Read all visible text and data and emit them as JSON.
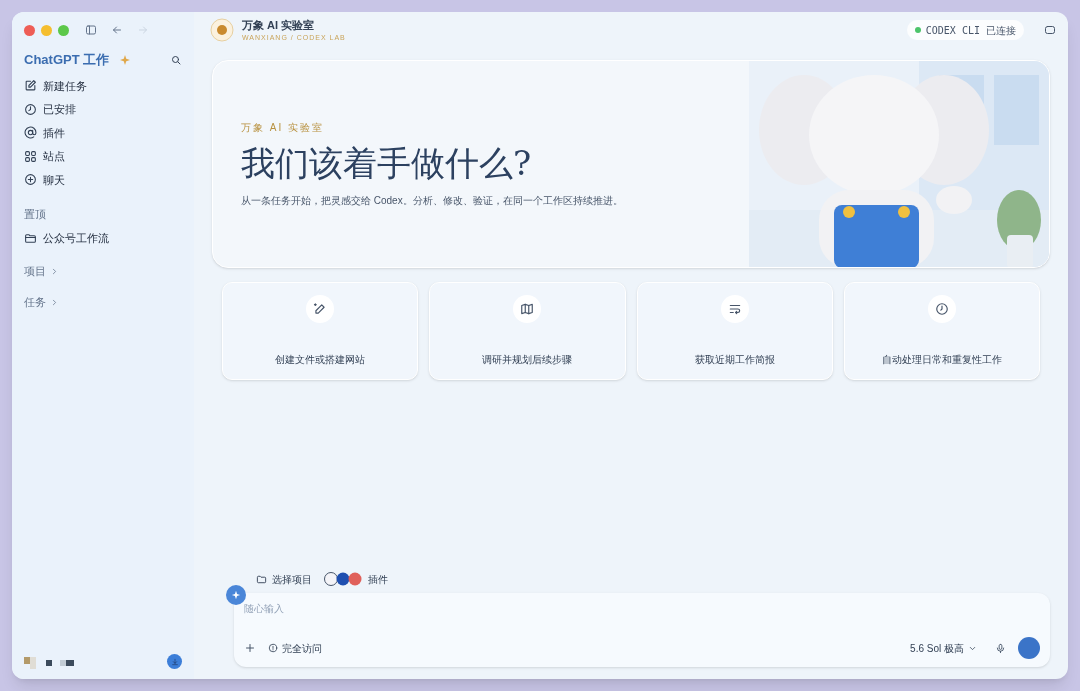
{
  "header": {
    "brand_title": "万象 AI 实验室",
    "brand_subtitle": "WANXIANG / CODEX LAB",
    "status": {
      "text": "CODEX CLI 已连接",
      "connected": true
    }
  },
  "sidebar": {
    "title": "ChatGPT 工作",
    "items": [
      {
        "kind": "edit",
        "label": "新建任务"
      },
      {
        "kind": "clock",
        "label": "已安排"
      },
      {
        "kind": "at",
        "label": "插件"
      },
      {
        "kind": "grid",
        "label": "站点"
      },
      {
        "kind": "plus",
        "label": "聊天"
      }
    ],
    "pinned_heading": "置顶",
    "pinned": [
      {
        "label": "公众号工作流"
      }
    ],
    "sections": [
      {
        "label": "项目"
      },
      {
        "label": "任务"
      }
    ]
  },
  "hero": {
    "eyebrow": "万象 AI 实验室",
    "title": "我们该着手做什么?",
    "subtitle": "从一条任务开始，把灵感交给 Codex。分析、修改、验证，在同一个工作区持续推进。"
  },
  "suggestions": [
    {
      "kind": "pen",
      "label": "创建文件或搭建网站"
    },
    {
      "kind": "map",
      "label": "调研并规划后续步骤"
    },
    {
      "kind": "list",
      "label": "获取近期工作简报"
    },
    {
      "kind": "clock",
      "label": "自动处理日常和重复性工作"
    }
  ],
  "composer": {
    "project_button": "选择项目",
    "plugins_button": "插件",
    "placeholder": "随心输入",
    "access_button": "完全访问",
    "model_button": "5.6 Sol 极高"
  }
}
